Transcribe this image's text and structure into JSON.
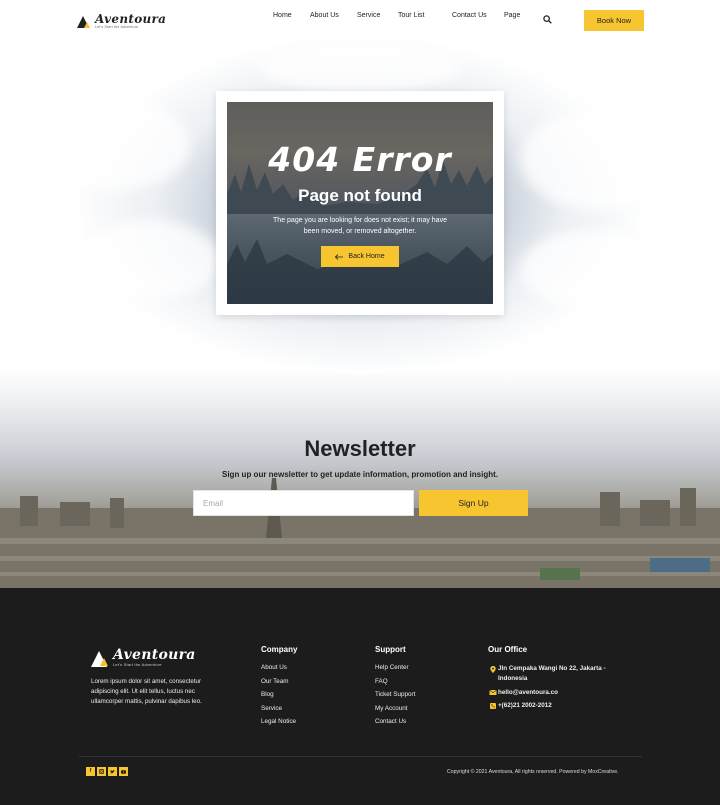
{
  "brand": {
    "name": "Aventoura",
    "tagline": "Let's Start the Adventure"
  },
  "header": {
    "nav": [
      {
        "label": "Home",
        "dropdown": false
      },
      {
        "label": "About Us",
        "dropdown": false
      },
      {
        "label": "Service",
        "dropdown": false
      },
      {
        "label": "Tour List",
        "dropdown": true
      },
      {
        "label": "Contact Us",
        "dropdown": false
      },
      {
        "label": "Page",
        "dropdown": true
      }
    ],
    "book_label": "Book Now"
  },
  "error": {
    "title": "404 Error",
    "subtitle": "Page not found",
    "description": "The page you are looking for does not exist; it may have been moved, or removed altogether.",
    "back_label": "Back Home"
  },
  "newsletter": {
    "title": "Newsletter",
    "subtitle": "Sign up our newsletter to get update information, promotion and insight.",
    "email_placeholder": "Email",
    "email_value": "",
    "signup_label": "Sign Up"
  },
  "footer": {
    "about": "Lorem ipsum dolor sit amet, consectetur adipiscing elit. Ut elit tellus, luctus nec ullamcorper mattis, pulvinar dapibus leo.",
    "company": {
      "title": "Company",
      "links": [
        "About Us",
        "Our Team",
        "Blog",
        "Service",
        "Legal Notice"
      ]
    },
    "support": {
      "title": "Support",
      "links": [
        "Help Center",
        "FAQ",
        "Ticket Support",
        "My Account",
        "Contact Us"
      ]
    },
    "office": {
      "title": "Our Office",
      "address": "Jln Cempaka Wangi No 22, Jakarta - Indonesia",
      "email": "hello@aventoura.co",
      "phone": "+(62)21 2002-2012"
    },
    "socials": [
      "facebook-icon",
      "instagram-icon",
      "twitter-icon",
      "youtube-icon"
    ],
    "copyright": "Copyright © 2021 Aventoura, All rights reserved. Powered by MoxCreative."
  },
  "colors": {
    "accent": "#f7c530",
    "dark": "#1c1c1c",
    "text": "#222222"
  }
}
